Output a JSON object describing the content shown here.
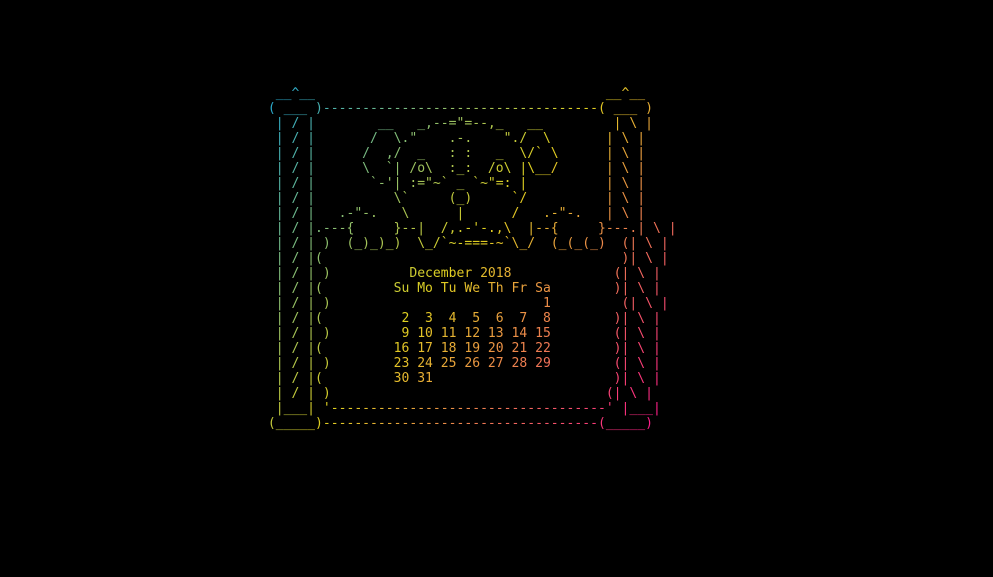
{
  "terminal": {
    "lines": [
      "  __^__                                     __^__",
      " ( ___ )-----------------------------------( ___ )",
      "  | / |        __   _,--=\"=--,_   __         | \\ |",
      "  | / |       /  \\.\"    .-.    \"./  \\       | \\ |",
      "  | / |      /  ,/  _   : :   _  \\/` \\      | \\ |",
      "  | / |      \\  `| /o\\  :_:  /o\\ |\\__/      | \\ |",
      "  | / |       `-'| :=\"~` _ `~\"=: |          | \\ |",
      "  | / |          \\`     (_)     `/          | \\ |",
      "  | / |   .-\"-.   \\      |      /   .-\"-.   | \\ |",
      "  | / |.---{     }--|  /,.-'-.,\\  |--{     }---.| \\ |",
      "  | / | )  (_)_)_)  \\_/`~-===-~`\\_/  (_(_(_)  (| \\ |",
      "  | / |(                                      )| \\ |",
      "  | / | )          December 2018             (| \\ |",
      "  | / |(         Su Mo Tu We Th Fr Sa        )| \\ |",
      "  | / | )                           1         (| \\ |",
      "  | / |(          2  3  4  5  6  7  8        )| \\ |",
      "  | / | )         9 10 11 12 13 14 15        (| \\ |",
      "  | / |(         16 17 18 19 20 21 22        )| \\ |",
      "  | / | )        23 24 25 26 27 28 29        (| \\ |",
      "  | / |(         30 31                       )| \\ |",
      "  | / | )                                   (| \\ |",
      "  |___| '-----------------------------------' |___|",
      " (_____)-----------------------------------(_____)"
    ]
  },
  "palette": {
    "start": "#20a8d6",
    "middle": "#e0d020",
    "end": "#ff1a8c"
  }
}
